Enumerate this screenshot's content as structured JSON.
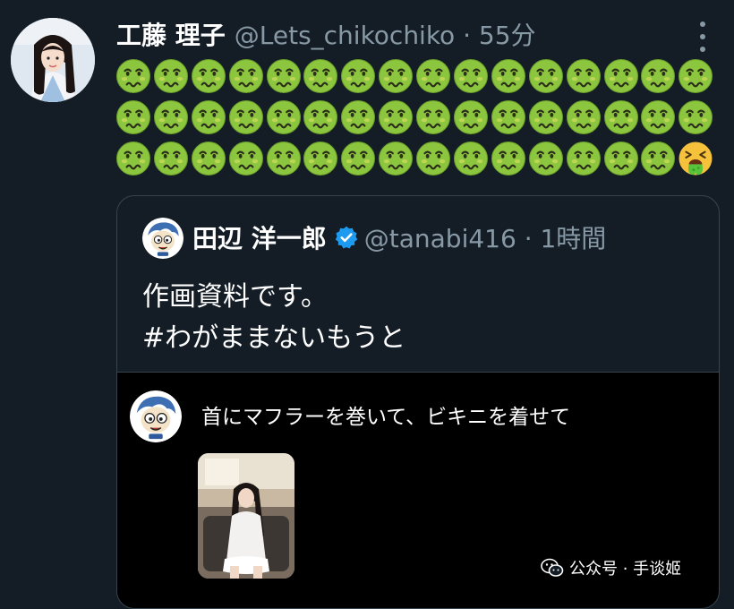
{
  "tweet": {
    "author_name": "工藤 理子",
    "author_meta": "@Lets_chikochiko · 55分",
    "avatar_icon": "user-avatar-icon",
    "more_icon": "more-vertical-icon",
    "emoji_rows": [
      [
        "nauseated-face",
        "nauseated-face",
        "nauseated-face",
        "nauseated-face",
        "nauseated-face",
        "nauseated-face",
        "nauseated-face",
        "nauseated-face",
        "nauseated-face",
        "nauseated-face",
        "nauseated-face",
        "nauseated-face",
        "nauseated-face",
        "nauseated-face",
        "nauseated-face",
        "nauseated-face"
      ],
      [
        "nauseated-face",
        "nauseated-face",
        "nauseated-face",
        "nauseated-face",
        "nauseated-face",
        "nauseated-face",
        "nauseated-face",
        "nauseated-face",
        "nauseated-face",
        "nauseated-face",
        "nauseated-face",
        "nauseated-face",
        "nauseated-face",
        "nauseated-face",
        "nauseated-face",
        "nauseated-face"
      ],
      [
        "nauseated-face",
        "nauseated-face",
        "nauseated-face",
        "nauseated-face",
        "nauseated-face",
        "nauseated-face",
        "nauseated-face",
        "nauseated-face",
        "nauseated-face",
        "nauseated-face",
        "nauseated-face",
        "nauseated-face",
        "nauseated-face",
        "nauseated-face",
        "nauseated-face",
        "vomiting-face"
      ]
    ]
  },
  "quote": {
    "author_name": "田辺 洋一郎",
    "author_meta": "@tanabi416 · 1時間",
    "verified_icon": "verified-badge-icon",
    "text_lines": [
      "作画資料です。",
      "#わがままないもうと"
    ],
    "media": {
      "text": "首にマフラーを巻いて、ビキニを着せて",
      "photo_icon": "photo-thumbnail"
    }
  },
  "watermark": {
    "text": "公众号 · 手谈姬",
    "icon": "wechat-icon"
  },
  "colors": {
    "background": "#141d26",
    "secondary_text": "#8899a6",
    "border": "#38444d",
    "verified": "#1d9bf0",
    "emoji_green": "#8cc63e"
  }
}
